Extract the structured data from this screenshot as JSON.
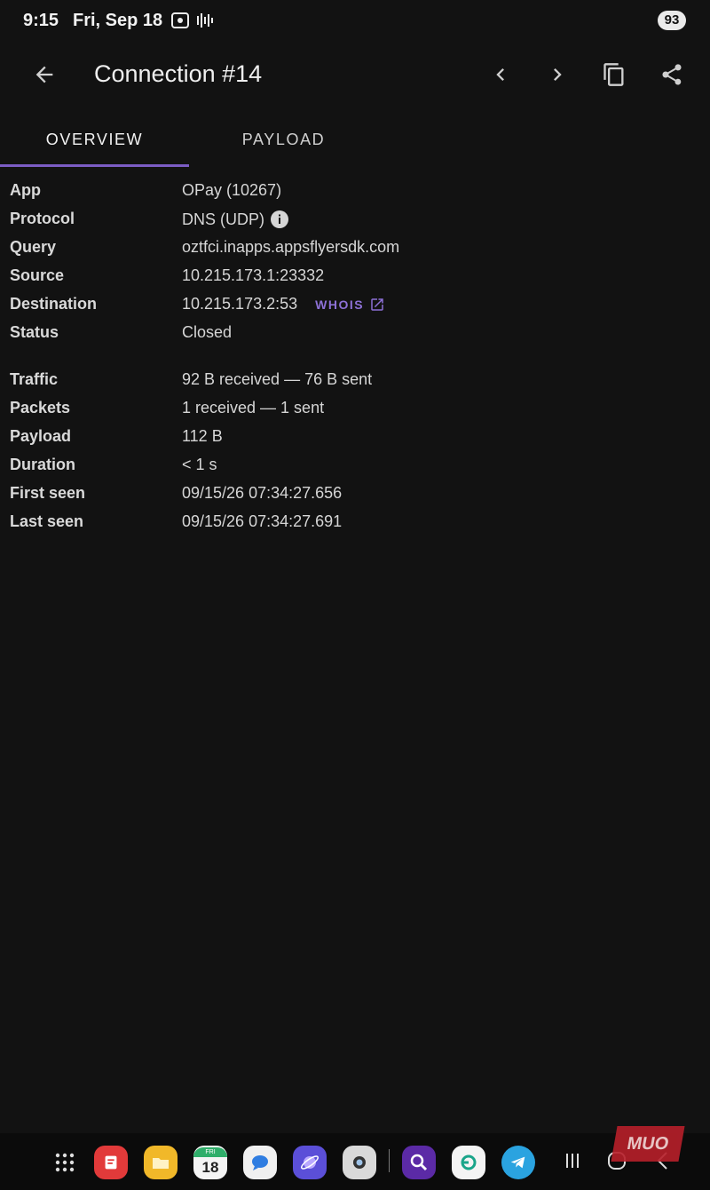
{
  "status_bar": {
    "time": "9:15",
    "date": "Fri, Sep 18",
    "battery": "93"
  },
  "app_bar": {
    "title": "Connection #14"
  },
  "tabs": [
    {
      "label": "OVERVIEW",
      "active": true
    },
    {
      "label": "PAYLOAD",
      "active": false
    }
  ],
  "details": {
    "app": {
      "label": "App",
      "value": "OPay (10267)"
    },
    "protocol": {
      "label": "Protocol",
      "value": "DNS (UDP)"
    },
    "query": {
      "label": "Query",
      "value": "oztfci.inapps.appsflyersdk.com"
    },
    "source": {
      "label": "Source",
      "value": "10.215.173.1:23332"
    },
    "destination": {
      "label": "Destination",
      "value": "10.215.173.2:53",
      "link": "WHOIS"
    },
    "status": {
      "label": "Status",
      "value": "Closed"
    },
    "traffic": {
      "label": "Traffic",
      "value": "92 B received — 76 B sent"
    },
    "packets": {
      "label": "Packets",
      "value": "1 received — 1 sent"
    },
    "payload": {
      "label": "Payload",
      "value": "112 B"
    },
    "duration": {
      "label": "Duration",
      "value": "< 1 s"
    },
    "first_seen": {
      "label": "First seen",
      "value": "09/15/26 07:34:27.656"
    },
    "last_seen": {
      "label": "Last seen",
      "value": "09/15/26 07:34:27.691"
    }
  },
  "dock": {
    "calendar_day": "FRI",
    "calendar_date": "18"
  },
  "watermark": "MUO",
  "colors": {
    "background": "#121212",
    "accent": "#7b5cc4"
  }
}
